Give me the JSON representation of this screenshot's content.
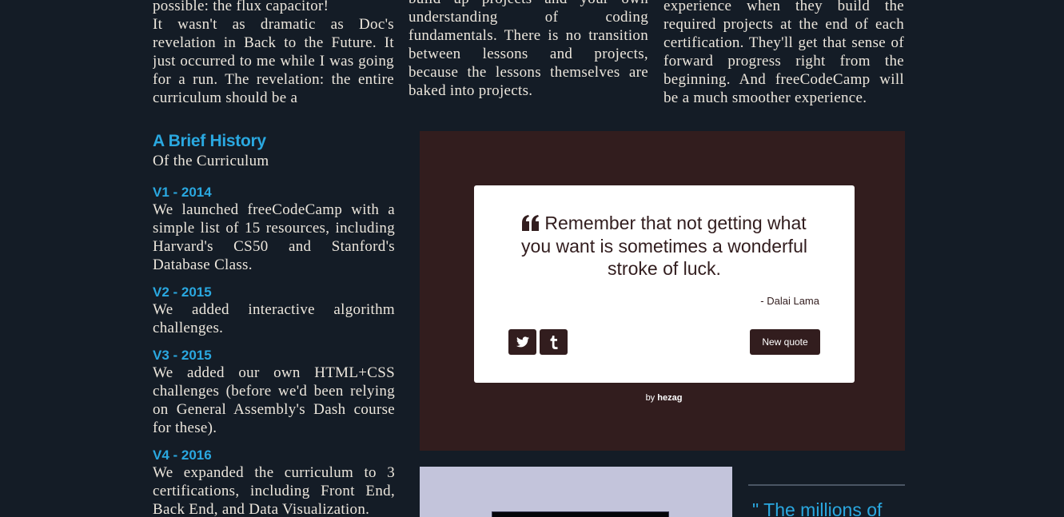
{
  "columns": {
    "col1": "possible: the flux capacitor! It wasn't as dramatic as Doc's revelation in Back to the Future. It just occurred to me while I was going for a run. The revelation: the entire curriculum should be a",
    "col1_first": "possible: the flux capacitor!",
    "col1_rest": "It wasn't as dramatic as Doc's revelation in Back to the Future. It just occurred to me while I was going for a run. The revelation: the entire curriculum should be a",
    "col2": "build up projects and your own understanding of coding fundamentals. There is no transition between lessons and projects, because the lessons themselves are baked into projects.",
    "col3": "experience when they build the required projects at the end of each certification. They'll get that sense of forward progress right from the beginning. And freeCodeCamp will be a much smoother experience."
  },
  "history": {
    "title": "A Brief History",
    "subtitle": "Of the Curriculum",
    "versions": [
      {
        "label": "V1 - 2014",
        "text": "We launched freeCodeCamp with a simple list of 15 resources, including Harvard's CS50 and Stanford's Database Class."
      },
      {
        "label": "V2 - 2015",
        "text": "We added interactive algorithm challenges."
      },
      {
        "label": "V3 - 2015",
        "text": "We added our own HTML+CSS challenges (before we'd been relying on General Assembly's Dash course for these)."
      },
      {
        "label": "V4 - 2016",
        "text": "We expanded the curriculum to 3 certifications, including Front End, Back End, and Data Visualization."
      }
    ]
  },
  "quote_machine": {
    "quote": "Remember that not getting what you want is sometimes a wonderful stroke of luck.",
    "author": "- Dalai Lama",
    "new_quote_label": "New quote",
    "byline_prefix": "by",
    "byline_name": "hezag",
    "icons": {
      "quote": "quote-left-icon",
      "twitter": "twitter-icon",
      "tumblr": "tumblr-icon"
    },
    "colors": {
      "panel": "#321d1e",
      "card": "#ffffff"
    }
  },
  "sidebar_quote": {
    "text": "\" The millions of"
  },
  "colors": {
    "background": "#141c26",
    "accent": "#2aa8e0",
    "body_text": "#ece6dc",
    "preview_bg": "#c3c4db"
  }
}
